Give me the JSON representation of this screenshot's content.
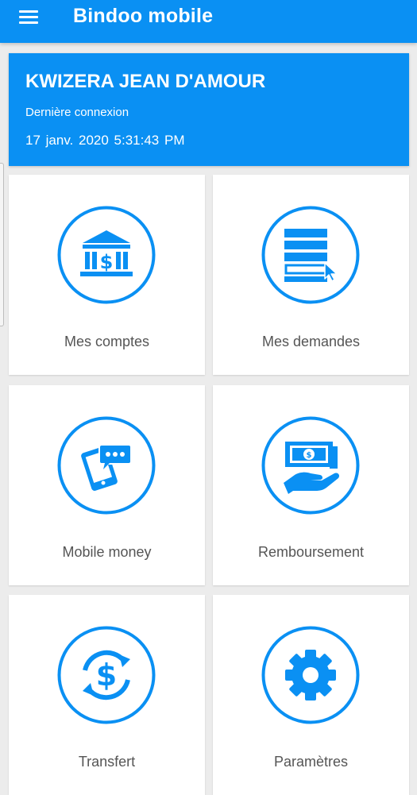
{
  "app": {
    "title": "Bindoo mobile",
    "menu_icon": "hamburger-menu-icon",
    "primary_color": "#0a90f3"
  },
  "user": {
    "name": "KWIZERA JEAN D'AMOUR",
    "last_login_label": "Dernière connexion",
    "last_login_value": "17 janv. 2020  5:31:43 PM"
  },
  "tiles": [
    {
      "label": "Mes comptes",
      "icon": "bank-icon"
    },
    {
      "label": "Mes demandes",
      "icon": "request-form-icon"
    },
    {
      "label": "Mobile money",
      "icon": "mobile-payment-icon"
    },
    {
      "label": "Remboursement",
      "icon": "repayment-icon"
    },
    {
      "label": "Transfert",
      "icon": "transfer-icon"
    },
    {
      "label": "Paramètres",
      "icon": "gear-icon"
    }
  ]
}
